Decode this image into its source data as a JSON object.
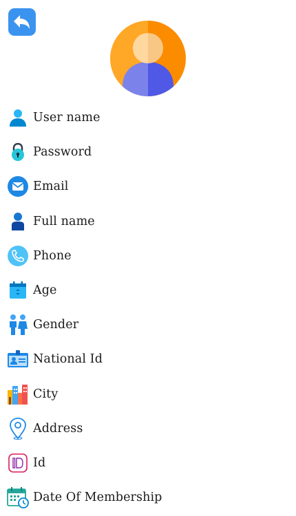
{
  "header": {
    "back_icon": "back-arrow-icon",
    "avatar_icon": "user-avatar-icon",
    "colors": {
      "back_button": "#3b93f0",
      "avatar_left": "#ffa726",
      "avatar_right": "#fb8c00"
    }
  },
  "fields": [
    {
      "label": "User name",
      "icon": "user-icon"
    },
    {
      "label": "Password",
      "icon": "padlock-icon"
    },
    {
      "label": "Email",
      "icon": "envelope-icon"
    },
    {
      "label": "Full name",
      "icon": "person-icon"
    },
    {
      "label": "Phone",
      "icon": "phone-icon"
    },
    {
      "label": "Age",
      "icon": "calendar-icon"
    },
    {
      "label": "Gender",
      "icon": "gender-icon"
    },
    {
      "label": "National Id",
      "icon": "id-card-icon"
    },
    {
      "label": "City",
      "icon": "city-icon"
    },
    {
      "label": "Address",
      "icon": "location-pin-icon"
    },
    {
      "label": "Id",
      "icon": "id-badge-icon"
    },
    {
      "label": "Date Of Membership",
      "icon": "calendar-clock-icon"
    }
  ]
}
